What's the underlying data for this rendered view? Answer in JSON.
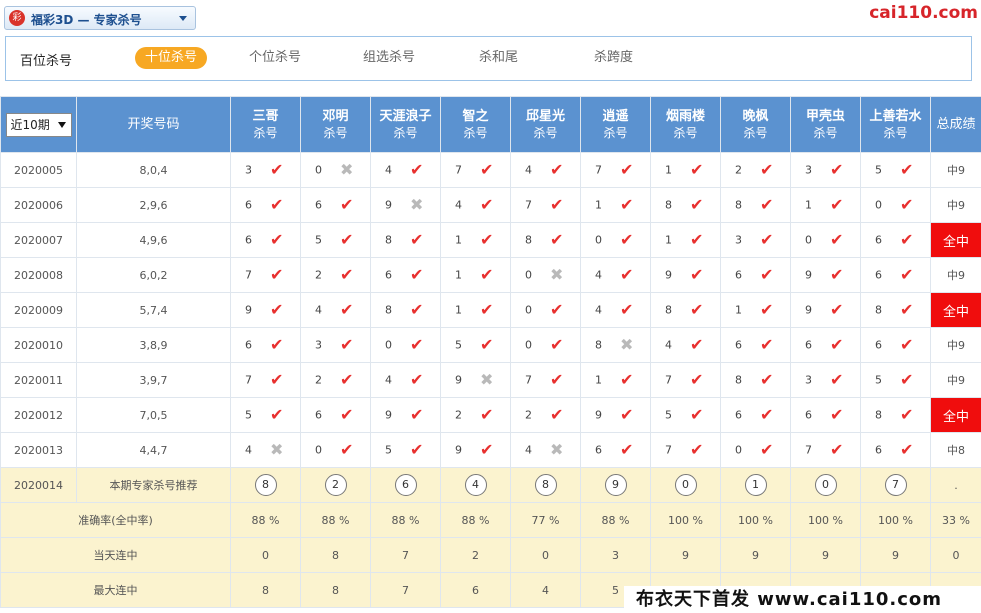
{
  "top": {
    "logo_glyph": "彩",
    "dropdown_label": "福彩3D — 专家杀号",
    "brand": "cai110.com"
  },
  "tabs": [
    {
      "label": "百位杀号",
      "state": "plain"
    },
    {
      "label": "十位杀号",
      "state": "active"
    },
    {
      "label": "个位杀号",
      "state": "inactive"
    },
    {
      "label": "组选杀号",
      "state": "inactive"
    },
    {
      "label": "杀和尾",
      "state": "inactive"
    },
    {
      "label": "杀跨度",
      "state": "inactive"
    }
  ],
  "table": {
    "period_select": "近10期",
    "col_draw": "开奖号码",
    "col_total": "总成绩",
    "experts": [
      {
        "name": "三哥",
        "sub": "杀号"
      },
      {
        "name": "邓明",
        "sub": "杀号"
      },
      {
        "name": "天涯浪子",
        "sub": "杀号"
      },
      {
        "name": "智之",
        "sub": "杀号"
      },
      {
        "name": "邱星光",
        "sub": "杀号"
      },
      {
        "name": "逍遥",
        "sub": "杀号"
      },
      {
        "name": "烟雨楼",
        "sub": "杀号"
      },
      {
        "name": "晚枫",
        "sub": "杀号"
      },
      {
        "name": "甲壳虫",
        "sub": "杀号"
      },
      {
        "name": "上善若水",
        "sub": "杀号"
      }
    ],
    "rows": [
      {
        "period": "2020005",
        "draw": "8,0,4",
        "picks": [
          [
            "3",
            true
          ],
          [
            "0",
            false
          ],
          [
            "4",
            true
          ],
          [
            "7",
            true
          ],
          [
            "4",
            true
          ],
          [
            "7",
            true
          ],
          [
            "1",
            true
          ],
          [
            "2",
            true
          ],
          [
            "3",
            true
          ],
          [
            "5",
            true
          ]
        ],
        "total": "中9",
        "all": false
      },
      {
        "period": "2020006",
        "draw": "2,9,6",
        "picks": [
          [
            "6",
            true
          ],
          [
            "6",
            true
          ],
          [
            "9",
            false
          ],
          [
            "4",
            true
          ],
          [
            "7",
            true
          ],
          [
            "1",
            true
          ],
          [
            "8",
            true
          ],
          [
            "8",
            true
          ],
          [
            "1",
            true
          ],
          [
            "0",
            true
          ]
        ],
        "total": "中9",
        "all": false
      },
      {
        "period": "2020007",
        "draw": "4,9,6",
        "picks": [
          [
            "6",
            true
          ],
          [
            "5",
            true
          ],
          [
            "8",
            true
          ],
          [
            "1",
            true
          ],
          [
            "8",
            true
          ],
          [
            "0",
            true
          ],
          [
            "1",
            true
          ],
          [
            "3",
            true
          ],
          [
            "0",
            true
          ],
          [
            "6",
            true
          ]
        ],
        "total": "全中",
        "all": true
      },
      {
        "period": "2020008",
        "draw": "6,0,2",
        "picks": [
          [
            "7",
            true
          ],
          [
            "2",
            true
          ],
          [
            "6",
            true
          ],
          [
            "1",
            true
          ],
          [
            "0",
            false
          ],
          [
            "4",
            true
          ],
          [
            "9",
            true
          ],
          [
            "6",
            true
          ],
          [
            "9",
            true
          ],
          [
            "6",
            true
          ]
        ],
        "total": "中9",
        "all": false
      },
      {
        "period": "2020009",
        "draw": "5,7,4",
        "picks": [
          [
            "9",
            true
          ],
          [
            "4",
            true
          ],
          [
            "8",
            true
          ],
          [
            "1",
            true
          ],
          [
            "0",
            true
          ],
          [
            "4",
            true
          ],
          [
            "8",
            true
          ],
          [
            "1",
            true
          ],
          [
            "9",
            true
          ],
          [
            "8",
            true
          ]
        ],
        "total": "全中",
        "all": true
      },
      {
        "period": "2020010",
        "draw": "3,8,9",
        "picks": [
          [
            "6",
            true
          ],
          [
            "3",
            true
          ],
          [
            "0",
            true
          ],
          [
            "5",
            true
          ],
          [
            "0",
            true
          ],
          [
            "8",
            false
          ],
          [
            "4",
            true
          ],
          [
            "6",
            true
          ],
          [
            "6",
            true
          ],
          [
            "6",
            true
          ]
        ],
        "total": "中9",
        "all": false
      },
      {
        "period": "2020011",
        "draw": "3,9,7",
        "picks": [
          [
            "7",
            true
          ],
          [
            "2",
            true
          ],
          [
            "4",
            true
          ],
          [
            "9",
            false
          ],
          [
            "7",
            true
          ],
          [
            "1",
            true
          ],
          [
            "7",
            true
          ],
          [
            "8",
            true
          ],
          [
            "3",
            true
          ],
          [
            "5",
            true
          ]
        ],
        "total": "中9",
        "all": false
      },
      {
        "period": "2020012",
        "draw": "7,0,5",
        "picks": [
          [
            "5",
            true
          ],
          [
            "6",
            true
          ],
          [
            "9",
            true
          ],
          [
            "2",
            true
          ],
          [
            "2",
            true
          ],
          [
            "9",
            true
          ],
          [
            "5",
            true
          ],
          [
            "6",
            true
          ],
          [
            "6",
            true
          ],
          [
            "8",
            true
          ]
        ],
        "total": "全中",
        "all": true
      },
      {
        "period": "2020013",
        "draw": "4,4,7",
        "picks": [
          [
            "4",
            false
          ],
          [
            "0",
            true
          ],
          [
            "5",
            true
          ],
          [
            "9",
            true
          ],
          [
            "4",
            false
          ],
          [
            "6",
            true
          ],
          [
            "7",
            true
          ],
          [
            "0",
            true
          ],
          [
            "7",
            true
          ],
          [
            "6",
            true
          ]
        ],
        "total": "中8",
        "all": false
      }
    ],
    "recommend": {
      "period": "2020014",
      "label": "本期专家杀号推荐",
      "balls": [
        "8",
        "2",
        "6",
        "4",
        "8",
        "9",
        "0",
        "1",
        "0",
        "7"
      ],
      "total": "."
    },
    "accuracy": {
      "label": "准确率(全中率)",
      "values": [
        "88 %",
        "88 %",
        "88 %",
        "88 %",
        "77 %",
        "88 %",
        "100 %",
        "100 %",
        "100 %",
        "100 %"
      ],
      "total": "33 %"
    },
    "today_streak": {
      "label": "当天连中",
      "values": [
        "0",
        "8",
        "7",
        "2",
        "0",
        "3",
        "9",
        "9",
        "9",
        "9"
      ],
      "total": "0"
    },
    "max_streak": {
      "label": "最大连中",
      "values": [
        "8",
        "8",
        "7",
        "6",
        "4",
        "5",
        "",
        "",
        "",
        ""
      ],
      "total": ""
    }
  },
  "footer": {
    "brand": "布衣天下首发 www.cai110.com"
  }
}
